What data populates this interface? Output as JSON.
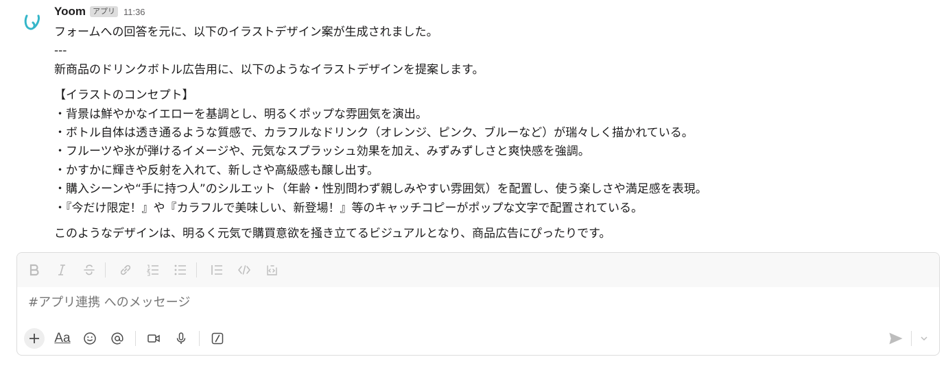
{
  "message": {
    "sender": "Yoom",
    "badge": "アプリ",
    "time": "11:36",
    "lines": [
      "フォームへの回答を元に、以下のイラストデザイン案が生成されました。",
      "---",
      "新商品のドリンクボトル広告用に、以下のようなイラストデザインを提案します。",
      "【イラストのコンセプト】",
      "・背景は鮮やかなイエローを基調とし、明るくポップな雰囲気を演出。",
      "・ボトル自体は透き通るような質感で、カラフルなドリンク（オレンジ、ピンク、ブルーなど）が瑞々しく描かれている。",
      "・フルーツや氷が弾けるイメージや、元気なスプラッシュ効果を加え、みずみずしさと爽快感を強調。",
      "・かすかに輝きや反射を入れて、新しさや高級感も醸し出す。",
      "・購入シーンや“手に持つ人”のシルエット（年齢・性別問わず親しみやすい雰囲気）を配置し、使う楽しさや満足感を表現。",
      "・『今だけ限定！』や『カラフルで美味しい、新登場！』等のキャッチコピーがポップな文字で配置されている。",
      "このようなデザインは、明るく元気で購買意欲を掻き立てるビジュアルとなり、商品広告にぴったりです。"
    ]
  },
  "composer": {
    "placeholder": "#アプリ連携 へのメッセージ",
    "aa_label": "Aa"
  },
  "colors": {
    "avatar_accent": "#35b6c9",
    "toolbar_icon": "#bcbcbc",
    "border": "#dcdcdc"
  }
}
